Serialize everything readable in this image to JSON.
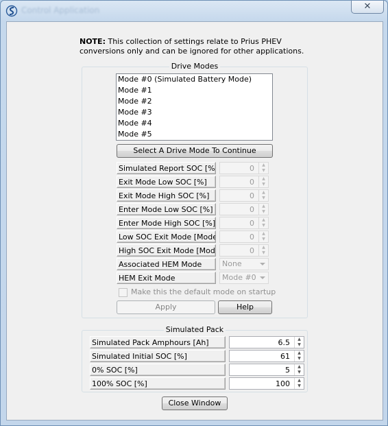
{
  "window": {
    "title": "Control Application",
    "close_glyph": "✕"
  },
  "note": {
    "bold": "NOTE:",
    "text": " This collection of settings relate to Prius PHEV conversions only and can be ignored for other applications."
  },
  "drive_modes": {
    "legend": "Drive Modes",
    "list": [
      "Mode #0 (Simulated Battery Mode)",
      "Mode #1",
      "Mode #2",
      "Mode #3",
      "Mode #4",
      "Mode #5"
    ],
    "select_button": "Select A Drive Mode To Continue",
    "fields": [
      {
        "label": "Simulated Report SOC [%]",
        "value": "0"
      },
      {
        "label": "Exit Mode Low SOC [%]",
        "value": "0"
      },
      {
        "label": "Exit Mode High SOC [%]",
        "value": "0"
      },
      {
        "label": "Enter Mode Low SOC [%]",
        "value": "0"
      },
      {
        "label": "Enter Mode High SOC [%]",
        "value": "0"
      },
      {
        "label": "Low SOC Exit Mode [Mode#]",
        "value": "0"
      },
      {
        "label": "High SOC Exit Mode [Mode#]",
        "value": "0"
      }
    ],
    "hem_mode": {
      "label": "Associated HEM Mode",
      "value": "None"
    },
    "hem_exit": {
      "label": "HEM Exit Mode",
      "value": "Mode #0"
    },
    "default_checkbox": "Make this the default mode on startup",
    "apply_button": "Apply",
    "help_button": "Help"
  },
  "simulated_pack": {
    "legend": "Simulated Pack",
    "fields": [
      {
        "label": "Simulated Pack Amphours [Ah]",
        "value": "6.5"
      },
      {
        "label": "Simulated Initial SOC [%]",
        "value": "61"
      },
      {
        "label": "0% SOC [%]",
        "value": "5"
      },
      {
        "label": "100% SOC [%]",
        "value": "100"
      }
    ]
  },
  "close_button": "Close Window",
  "colors": {
    "accent": "#6d8fb5",
    "client_bg": "#f0f0f0"
  },
  "icons": {
    "app": "app-logo-icon",
    "spin_up": "up-arrow-icon",
    "spin_down": "down-arrow-icon",
    "combo": "chevron-down-icon"
  }
}
